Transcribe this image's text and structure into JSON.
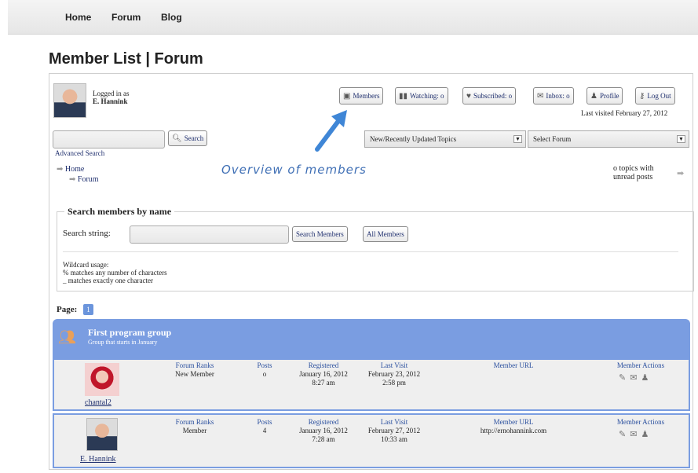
{
  "nav": {
    "home": "Home",
    "forum": "Forum",
    "blog": "Blog"
  },
  "page_title": "Member List | Forum",
  "user": {
    "logged_in_as": "Logged in as",
    "name": "E. Hannink",
    "last_visited": "Last visited February 27, 2012"
  },
  "toolbar": {
    "members": "Members",
    "watching": "Watching: o",
    "subscribed": "Subscribed: o",
    "inbox": "Inbox: o",
    "profile": "Profile",
    "logout": "Log Out"
  },
  "search": {
    "button": "Search",
    "advanced": "Advanced Search"
  },
  "filters": {
    "topics_select": "New/Recently Updated Topics",
    "forum_select": "Select Forum"
  },
  "breadcrumb": {
    "home": "Home",
    "forum": "Forum"
  },
  "unread": {
    "line1": "o topics with",
    "line2": "unread posts"
  },
  "annotation": "Overview of members",
  "member_search": {
    "legend": "Search members by name",
    "label": "Search string:",
    "search_button": "Search Members",
    "all_button": "All Members",
    "wildcard_title": "Wildcard usage:",
    "wildcard_1": "% matches any number of characters",
    "wildcard_2": "_ matches exactly one character"
  },
  "pagination": {
    "label": "Page:",
    "current": "1"
  },
  "group": {
    "title": "First program group",
    "subtitle": "Group that starts in January"
  },
  "columns": {
    "ranks": "Forum Ranks",
    "posts": "Posts",
    "registered": "Registered",
    "last_visit": "Last Visit",
    "url": "Member URL",
    "actions": "Member Actions"
  },
  "members": [
    {
      "name": "chantal2",
      "rank": "New Member",
      "posts": "o",
      "registered_date": "January 16, 2012",
      "registered_time": "8:27 am",
      "last_visit_date": "February 23, 2012",
      "last_visit_time": "2:58 pm",
      "url": ""
    },
    {
      "name": "E. Hannink",
      "rank": "Member",
      "posts": "4",
      "registered_date": "January 16, 2012",
      "registered_time": "7:28 am",
      "last_visit_date": "February 27, 2012",
      "last_visit_time": "10:33 am",
      "url": "http://ernohannink.com"
    }
  ],
  "colors": {
    "group_header": "#7a9de1",
    "annotation": "#3f6fb5",
    "link": "#1f2f6e"
  }
}
